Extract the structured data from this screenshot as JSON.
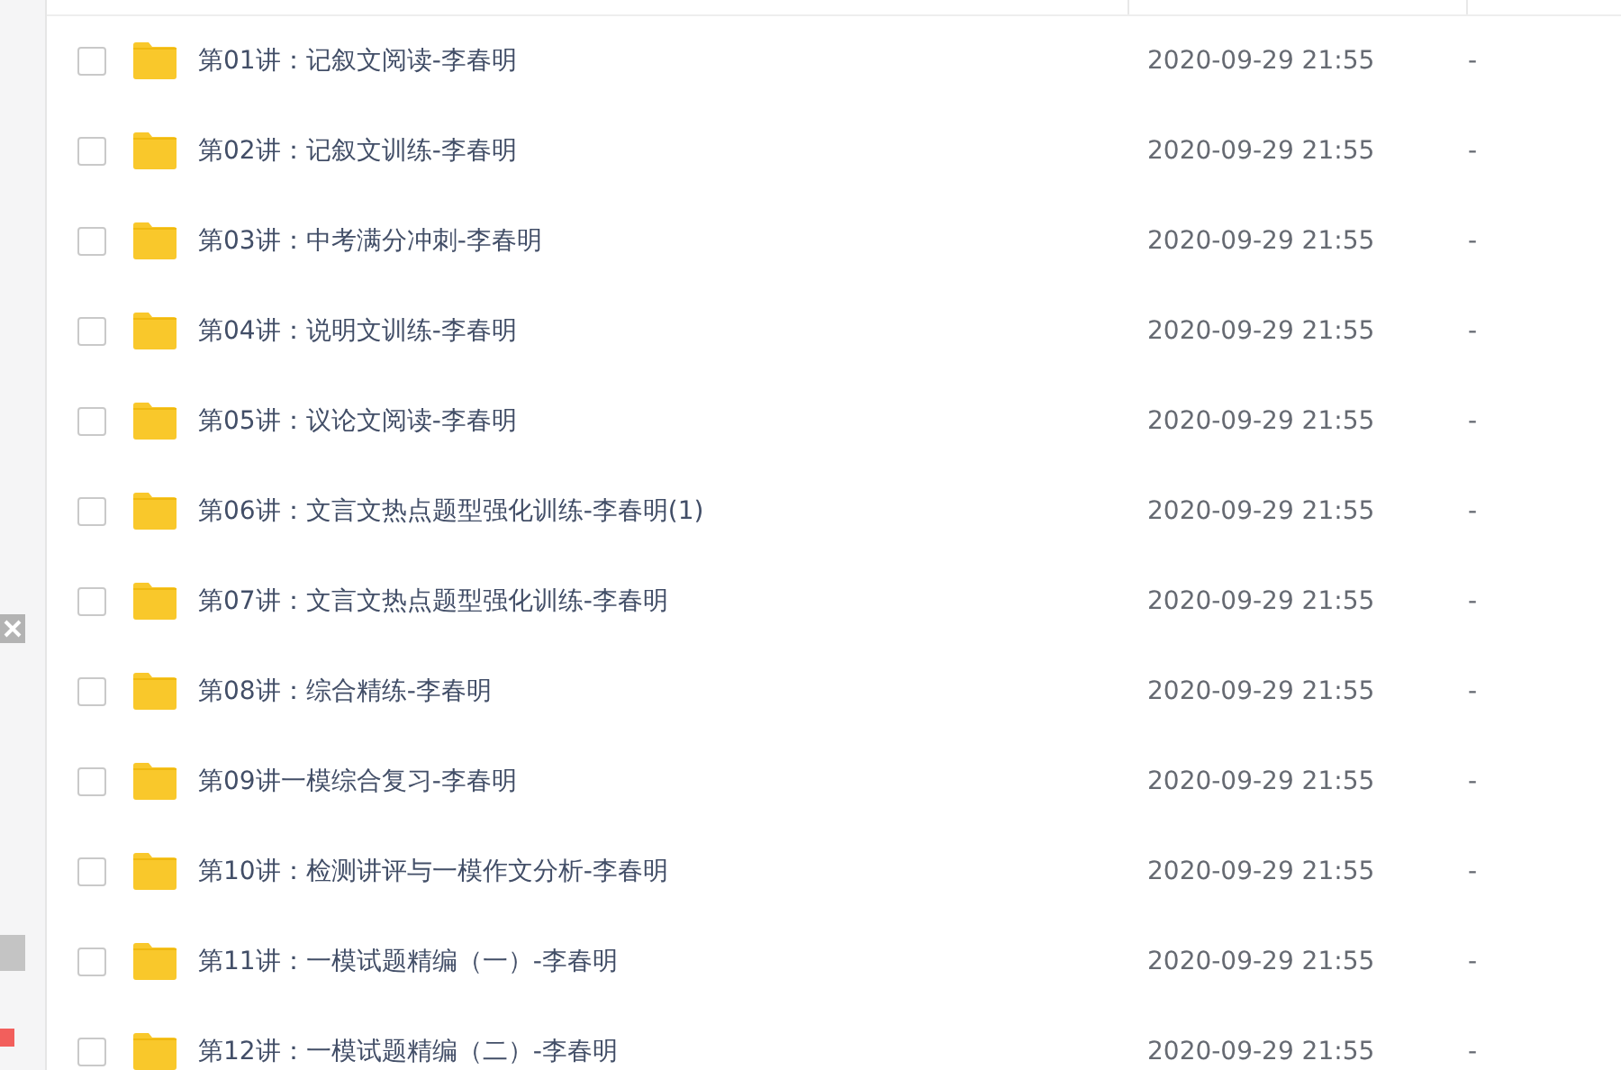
{
  "files": [
    {
      "name": "第01讲：记叙文阅读-李春明",
      "modified": "2020-09-29 21:55",
      "size": "-",
      "checked": false
    },
    {
      "name": "第02讲：记叙文训练-李春明",
      "modified": "2020-09-29 21:55",
      "size": "-",
      "checked": false
    },
    {
      "name": "第03讲：中考满分冲刺-李春明",
      "modified": "2020-09-29 21:55",
      "size": "-",
      "checked": false
    },
    {
      "name": "第04讲：说明文训练-李春明",
      "modified": "2020-09-29 21:55",
      "size": "-",
      "checked": false
    },
    {
      "name": "第05讲：议论文阅读-李春明",
      "modified": "2020-09-29 21:55",
      "size": "-",
      "checked": false
    },
    {
      "name": "第06讲：文言文热点题型强化训练-李春明(1)",
      "modified": "2020-09-29 21:55",
      "size": "-",
      "checked": false
    },
    {
      "name": "第07讲：文言文热点题型强化训练-李春明",
      "modified": "2020-09-29 21:55",
      "size": "-",
      "checked": false
    },
    {
      "name": "第08讲：综合精练-李春明",
      "modified": "2020-09-29 21:55",
      "size": "-",
      "checked": false
    },
    {
      "name": "第09讲一模综合复习-李春明",
      "modified": "2020-09-29 21:55",
      "size": "-",
      "checked": false
    },
    {
      "name": "第10讲：检测讲评与一模作文分析-李春明",
      "modified": "2020-09-29 21:55",
      "size": "-",
      "checked": false
    },
    {
      "name": "第11讲：一模试题精编（一）-李春明",
      "modified": "2020-09-29 21:55",
      "size": "-",
      "checked": false
    },
    {
      "name": "第12讲：一模试题精编（二）-李春明",
      "modified": "2020-09-29 21:55",
      "size": "-",
      "checked": false
    }
  ]
}
